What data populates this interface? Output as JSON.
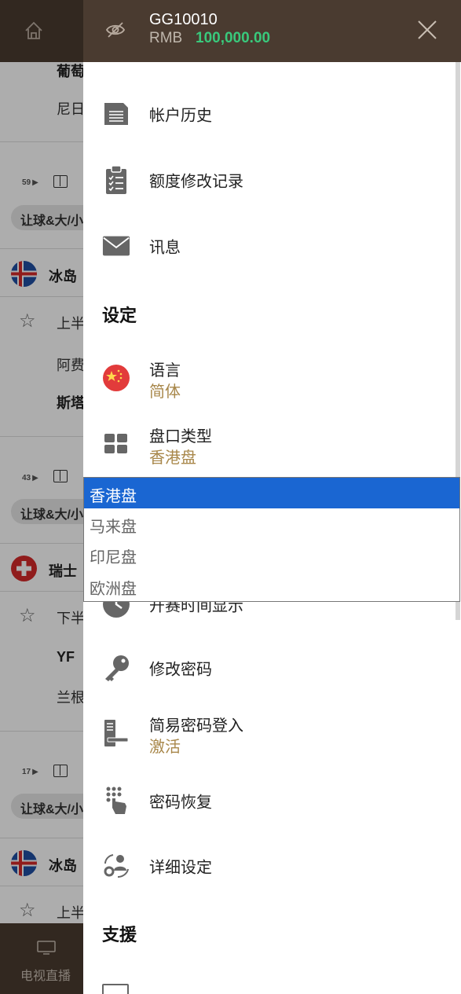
{
  "background": {
    "rows": [
      {
        "text": "葡萄",
        "bold": true
      },
      {
        "text": "尼日"
      },
      {
        "count": "59"
      },
      {
        "pill": "让球&大/小"
      },
      {
        "league": "冰岛"
      },
      {
        "text": "上半"
      },
      {
        "text": "阿费"
      },
      {
        "text": "斯塔",
        "bold": true
      },
      {
        "count": "43"
      },
      {
        "pill": "让球&大/小"
      },
      {
        "league": "瑞士"
      },
      {
        "text": "下半"
      },
      {
        "text": "YF",
        "bold": true
      },
      {
        "text": "兰根"
      },
      {
        "count": "17"
      },
      {
        "pill": "让球&大/小"
      },
      {
        "league": "冰岛"
      },
      {
        "text": "上半"
      }
    ],
    "bottom_nav": {
      "tv_label": "电视直播"
    }
  },
  "header": {
    "username": "GG10010",
    "currency": "RMB",
    "balance": "100,000.00"
  },
  "menu": {
    "account_history": "帐户历史",
    "credit_log": "额度修改记录",
    "messages": "讯息",
    "settings_title": "设定",
    "language": "语言",
    "language_value": "简体",
    "odds_type": "盘口类型",
    "odds_type_value": "香港盘",
    "start_time": "开赛时间显示",
    "change_password": "修改密码",
    "easy_login": "简易密码登入",
    "easy_login_value": "激活",
    "password_recovery": "密码恢复",
    "detail_settings": "详细设定",
    "support_title": "支援"
  },
  "dropdown": {
    "options": [
      "香港盘",
      "马来盘",
      "印尼盘",
      "欧洲盘"
    ],
    "selected": "香港盘"
  },
  "colors": {
    "header_bg": "#4a3b30",
    "balance": "#39c97c",
    "sub_value": "#a8874a",
    "selected_option": "#1a66d2"
  }
}
